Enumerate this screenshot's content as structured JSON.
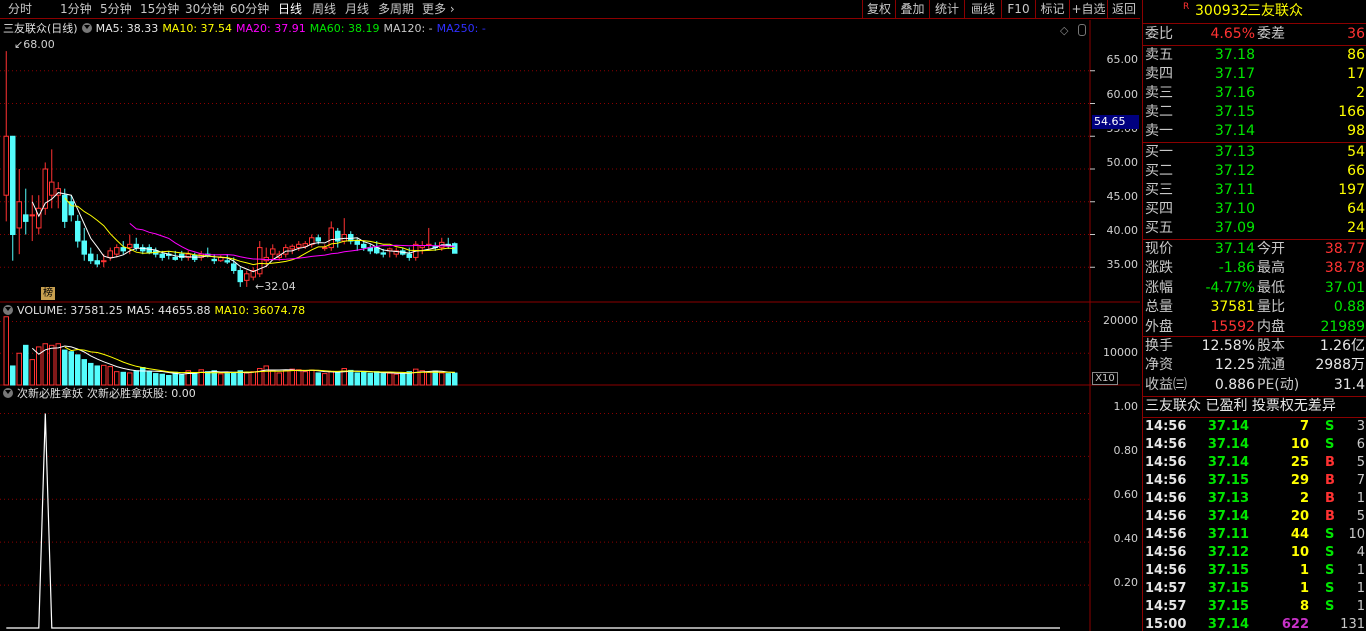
{
  "toolbar": {
    "periods": [
      "分时",
      "1分钟",
      "5分钟",
      "15分钟",
      "30分钟",
      "60分钟",
      "日线",
      "周线",
      "月线",
      "多周期",
      "更多"
    ],
    "active_period": "日线",
    "buttons": [
      "复权",
      "叠加",
      "统计",
      "画线",
      "F10",
      "标记",
      "+自选",
      "返回"
    ]
  },
  "kline": {
    "title": "三友联众(日线)",
    "ma5": "MA5: 38.33",
    "ma10": "MA10: 37.54",
    "ma20": "MA20: 37.91",
    "ma60": "MA60: 38.19",
    "ma120": "MA120: -",
    "ma250": "MA250: -",
    "high_label": "68.00",
    "low_label": "32.04",
    "marker": "榜",
    "current_price_tag": "54.65",
    "y_ticks": [
      "65.00",
      "60.00",
      "55.00",
      "50.00",
      "45.00",
      "40.00",
      "35.00"
    ]
  },
  "volume": {
    "title": "VOLUME: 37581.25",
    "ma5": "MA5: 44655.88",
    "ma10": "MA10: 36074.78",
    "y_ticks": [
      "20000",
      "10000"
    ],
    "unit": "X10"
  },
  "indicator": {
    "title": "次新必胜拿妖",
    "value": "次新必胜拿妖股: 0.00",
    "y_ticks": [
      "1.00",
      "0.80",
      "0.60",
      "0.40",
      "0.20"
    ]
  },
  "colors": {
    "up": "#ff3232",
    "down": "#54fcfc",
    "ma5": "#ffffff",
    "ma10": "#ffff00",
    "ma20": "#ff00ff",
    "ma60": "#00e600",
    "border": "#8b0000"
  },
  "chart_data": {
    "type": "candlestick",
    "candles": [
      [
        46,
        68,
        42,
        55
      ],
      [
        55,
        52,
        36,
        40
      ],
      [
        41,
        50,
        37,
        45
      ],
      [
        43,
        47,
        40,
        42
      ],
      [
        43,
        46,
        39,
        43
      ],
      [
        41,
        46,
        40,
        44
      ],
      [
        44,
        51,
        43,
        50
      ],
      [
        46,
        53,
        44,
        48
      ],
      [
        46,
        48,
        44,
        47
      ],
      [
        46,
        47,
        41,
        42
      ],
      [
        45,
        46,
        42,
        43
      ],
      [
        42,
        43,
        38,
        39
      ],
      [
        39,
        41,
        36,
        37
      ],
      [
        37,
        38,
        35.5,
        36
      ],
      [
        36,
        37,
        35,
        35.5
      ],
      [
        36,
        37,
        35,
        36
      ],
      [
        36.5,
        38,
        36,
        37.5
      ],
      [
        37,
        38.5,
        36.5,
        38
      ],
      [
        38,
        39,
        37,
        37.5
      ],
      [
        38,
        40,
        37,
        38.5
      ],
      [
        38.5,
        39.5,
        37.5,
        38
      ],
      [
        38,
        38.5,
        37,
        37.5
      ],
      [
        38,
        38.5,
        37,
        37.2
      ],
      [
        37.5,
        38,
        36.5,
        37
      ],
      [
        37,
        37.5,
        36,
        36.5
      ],
      [
        37,
        37.5,
        36.2,
        36.8
      ],
      [
        36.5,
        37.5,
        36,
        36.2
      ],
      [
        37,
        37.5,
        36,
        36.5
      ],
      [
        36.5,
        37.5,
        36,
        37
      ],
      [
        36.8,
        37.2,
        35.8,
        36.2
      ],
      [
        36.5,
        37.5,
        36,
        37
      ],
      [
        37,
        38,
        36.5,
        36.8
      ],
      [
        36.2,
        37,
        35.5,
        36
      ],
      [
        36,
        36.8,
        35.8,
        36.5
      ],
      [
        36,
        37,
        35.5,
        35.8
      ],
      [
        35.5,
        36.5,
        34,
        34.5
      ],
      [
        34.5,
        35,
        32,
        32.8
      ],
      [
        33,
        34.5,
        32,
        34
      ],
      [
        33.5,
        35,
        33,
        34.5
      ],
      [
        34,
        39,
        33.5,
        38
      ],
      [
        36,
        38,
        35,
        36.5
      ],
      [
        37,
        38.5,
        36,
        37.8
      ],
      [
        36.5,
        37.5,
        36,
        37
      ],
      [
        37,
        38.5,
        36.5,
        38
      ],
      [
        37.8,
        38.5,
        37,
        38.2
      ],
      [
        38,
        39,
        37.5,
        38.5
      ],
      [
        38.2,
        39,
        37.8,
        38.6
      ],
      [
        38.5,
        40,
        38,
        39.5
      ],
      [
        39.5,
        40,
        38.5,
        39
      ],
      [
        38,
        38.5,
        37.5,
        38
      ],
      [
        38,
        42,
        37.5,
        41
      ],
      [
        40.5,
        41,
        38,
        39
      ],
      [
        39,
        42.5,
        38.5,
        40
      ],
      [
        40,
        40.5,
        38.5,
        39
      ],
      [
        39,
        39.5,
        37.5,
        38.5
      ],
      [
        38.5,
        39,
        37.5,
        38
      ],
      [
        38,
        38.5,
        37,
        37.5
      ],
      [
        38,
        39,
        37,
        37.2
      ],
      [
        37.2,
        37.8,
        36.5,
        37
      ],
      [
        37.5,
        38,
        36.5,
        37.8
      ],
      [
        37,
        38,
        36.5,
        37.5
      ],
      [
        37.5,
        38,
        36.8,
        37
      ],
      [
        37,
        38,
        36,
        36.5
      ],
      [
        36.5,
        39,
        36,
        38.5
      ],
      [
        38,
        39,
        37,
        38.3
      ],
      [
        38.5,
        41,
        37.5,
        38.5
      ],
      [
        38.2,
        38.8,
        37.5,
        38
      ],
      [
        38,
        39.5,
        37.5,
        38.8
      ],
      [
        38.5,
        39.5,
        37.8,
        38.3
      ],
      [
        38.6,
        38.8,
        37.6,
        37.14
      ]
    ],
    "volumes": [
      21500,
      6000,
      10000,
      12500,
      8000,
      12000,
      13000,
      12500,
      13000,
      11000,
      10500,
      9500,
      8000,
      6800,
      6000,
      6200,
      5800,
      4200,
      4000,
      3800,
      4500,
      5500,
      4200,
      3600,
      3400,
      3000,
      4000,
      3200,
      4500,
      3500,
      4800,
      4200,
      4500,
      3500,
      3600,
      4000,
      4500,
      3800,
      4200,
      5200,
      6000,
      4500,
      3800,
      4500,
      5000,
      4800,
      4200,
      4700,
      3800,
      3600,
      4300,
      4000,
      5200,
      4600,
      3800,
      4000,
      3700,
      4200,
      3600,
      3700,
      3400,
      3600,
      4200,
      5000,
      4500,
      4000,
      4400,
      3800,
      3600,
      3758
    ],
    "indicator_values": {
      "spike_index": 6,
      "spike_value": 1.0,
      "other_value": 0.0
    },
    "ylim": [
      30,
      70
    ],
    "vol_ylim": [
      0,
      23000
    ],
    "ind_ylim": [
      0,
      1.1
    ]
  },
  "panel": {
    "code": "300932",
    "name": "三友联众",
    "r_badge": "R",
    "weibi": {
      "label": "委比",
      "value": "4.65%",
      "label2": "委差",
      "value2": "36"
    },
    "asks": [
      {
        "label": "卖五",
        "price": "37.18",
        "vol": "86"
      },
      {
        "label": "卖四",
        "price": "37.17",
        "vol": "17"
      },
      {
        "label": "卖三",
        "price": "37.16",
        "vol": "2"
      },
      {
        "label": "卖二",
        "price": "37.15",
        "vol": "166"
      },
      {
        "label": "卖一",
        "price": "37.14",
        "vol": "98"
      }
    ],
    "bids": [
      {
        "label": "买一",
        "price": "37.13",
        "vol": "54"
      },
      {
        "label": "买二",
        "price": "37.12",
        "vol": "66"
      },
      {
        "label": "买三",
        "price": "37.11",
        "vol": "197"
      },
      {
        "label": "买四",
        "price": "37.10",
        "vol": "64"
      },
      {
        "label": "买五",
        "price": "37.09",
        "vol": "24"
      }
    ],
    "quote": [
      {
        "l1": "现价",
        "v1": "37.14",
        "c1": "green",
        "l2": "今开",
        "v2": "38.77",
        "c2": "red"
      },
      {
        "l1": "涨跌",
        "v1": "-1.86",
        "c1": "green",
        "l2": "最高",
        "v2": "38.78",
        "c2": "red"
      },
      {
        "l1": "涨幅",
        "v1": "-4.77%",
        "c1": "green",
        "l2": "最低",
        "v2": "37.01",
        "c2": "green"
      },
      {
        "l1": "总量",
        "v1": "37581",
        "c1": "yellow",
        "l2": "量比",
        "v2": "0.88",
        "c2": "green"
      },
      {
        "l1": "外盘",
        "v1": "15592",
        "c1": "red",
        "l2": "内盘",
        "v2": "21989",
        "c2": "green"
      }
    ],
    "fund": [
      {
        "l1": "换手",
        "v1": "12.58%",
        "l2": "股本",
        "v2": "1.26亿"
      },
      {
        "l1": "净资",
        "v1": "12.25",
        "l2": "流通",
        "v2": "2988万"
      },
      {
        "l1": "收益㈢",
        "v1": "0.886",
        "l2": "PE(动)",
        "v2": "31.4"
      }
    ],
    "tags": "三友联众 已盈利 投票权无差异",
    "ticks": [
      {
        "time": "14:56",
        "price": "37.14",
        "vol": "7",
        "bs": "S",
        "n": "3"
      },
      {
        "time": "14:56",
        "price": "37.14",
        "vol": "10",
        "bs": "S",
        "n": "6"
      },
      {
        "time": "14:56",
        "price": "37.14",
        "vol": "25",
        "bs": "B",
        "n": "5"
      },
      {
        "time": "14:56",
        "price": "37.15",
        "vol": "29",
        "bs": "B",
        "n": "7"
      },
      {
        "time": "14:56",
        "price": "37.13",
        "vol": "2",
        "bs": "B",
        "n": "1"
      },
      {
        "time": "14:56",
        "price": "37.14",
        "vol": "20",
        "bs": "B",
        "n": "5"
      },
      {
        "time": "14:56",
        "price": "37.11",
        "vol": "44",
        "bs": "S",
        "n": "10"
      },
      {
        "time": "14:56",
        "price": "37.12",
        "vol": "10",
        "bs": "S",
        "n": "4"
      },
      {
        "time": "14:56",
        "price": "37.15",
        "vol": "1",
        "bs": "S",
        "n": "1"
      },
      {
        "time": "14:57",
        "price": "37.15",
        "vol": "1",
        "bs": "S",
        "n": "1"
      },
      {
        "time": "14:57",
        "price": "37.15",
        "vol": "8",
        "bs": "S",
        "n": "1"
      },
      {
        "time": "15:00",
        "price": "37.14",
        "vol": "622",
        "bs": "",
        "n": "131"
      }
    ]
  }
}
